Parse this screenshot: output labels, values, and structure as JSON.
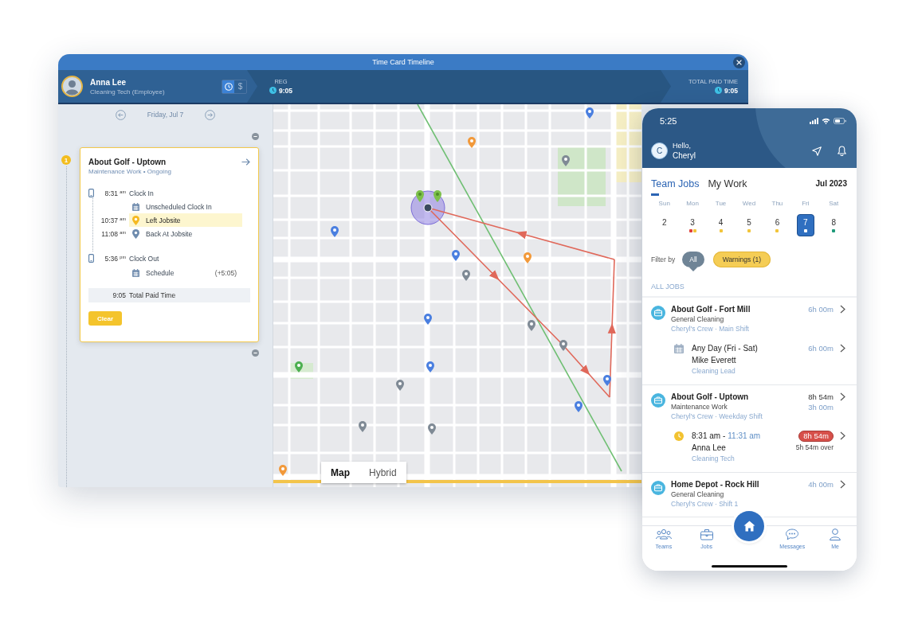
{
  "window": {
    "title": "Time Card Timeline"
  },
  "employee": {
    "name": "Anna Lee",
    "role": "Cleaning Tech (Employee)"
  },
  "view_toggle": [
    {
      "kind": "time",
      "selected": true
    },
    {
      "kind": "pay",
      "label": "$",
      "selected": false
    }
  ],
  "totals": [
    {
      "label": "REG",
      "value": "9:05"
    },
    {
      "label": "TOTAL PAID TIME",
      "value": "9:05"
    }
  ],
  "timeline": {
    "date": "Friday, Jul 7",
    "entries": [
      {
        "number": "1",
        "title": "About Golf - Uptown",
        "subtitle": "Maintenance Work • Ongoing",
        "events": [
          {
            "kind": "device",
            "time": "8:31 $^{am}$",
            "label": "Clock In",
            "highlighted": false
          },
          {
            "kind": "schedule",
            "label": "Unscheduled Clock In",
            "highlighted": false
          },
          {
            "kind": "location",
            "time": "10:37 $^{am}$",
            "label": "Left Jobsite",
            "highlighted": true
          },
          {
            "kind": "location",
            "time": "11:08 $^{am}$",
            "label": "Back At Jobsite",
            "highlighted": false
          },
          {
            "kind": "device",
            "time": "5:36 $^{pm}$",
            "label": "Clock Out",
            "highlighted": false
          },
          {
            "kind": "schedule",
            "label": "Schedule",
            "note": "(+5:05)",
            "highlighted": false
          }
        ],
        "total": {
          "value": "9:05",
          "label": "Total Paid Time"
        },
        "button": "Clear"
      }
    ]
  },
  "map": {
    "types": [
      {
        "label": "Map",
        "selected": true
      },
      {
        "label": "Hybrid",
        "selected": false
      }
    ]
  },
  "phone": {
    "clock": "5:25",
    "avatar_letter": "C",
    "greeting": "Hello,",
    "user": "Cheryl",
    "tabs": [
      {
        "label": "Team Jobs",
        "selected": true
      },
      {
        "label": "My Work",
        "selected": false
      }
    ],
    "month": "Jul 2023",
    "week": [
      {
        "day": "Sun",
        "date": "2",
        "selected": false
      },
      {
        "day": "Mon",
        "date": "3",
        "selected": false,
        "dots": [
          {
            "color": "#e0413a"
          },
          {
            "color": "#f2c53b"
          }
        ]
      },
      {
        "day": "Tue",
        "date": "4",
        "selected": false,
        "dots": [
          {
            "color": "#f2c53b"
          }
        ]
      },
      {
        "day": "Wed",
        "date": "5",
        "selected": false,
        "dots": [
          {
            "color": "#f2c53b"
          }
        ]
      },
      {
        "day": "Thu",
        "date": "6",
        "selected": false,
        "dots": [
          {
            "color": "#f2c53b"
          }
        ]
      },
      {
        "day": "Fri",
        "date": "7",
        "selected": true,
        "dots": [
          {
            "color": "#ffffff"
          }
        ]
      },
      {
        "day": "Sat",
        "date": "8",
        "selected": false,
        "dots": [
          {
            "color": "#1f9a7a"
          }
        ]
      }
    ],
    "filter": {
      "label": "Filter by",
      "chips": [
        {
          "label": "All",
          "kind": "all",
          "selected": true
        },
        {
          "label": "Warnings (1)",
          "kind": "warning",
          "selected": false
        }
      ]
    },
    "section": "ALL JOBS",
    "jobs": [
      {
        "title": "About Golf - Fort Mill",
        "type": "General Cleaning",
        "crew": "Cheryl's Crew · Main Shift",
        "hours": [
          {
            "text": "6h 00m",
            "kind": "scheduled"
          }
        ],
        "shifts": [
          {
            "kind": "open",
            "when": "Any Day (Fri - Sat)",
            "person": "Mike Everett",
            "role": "Cleaning Lead",
            "hours": [
              {
                "text": "6h 00m",
                "kind": "scheduled"
              }
            ]
          }
        ]
      },
      {
        "title": "About Golf - Uptown",
        "type": "Maintenance Work",
        "crew": "Cheryl's Crew · Weekday Shift",
        "hours": [
          {
            "text": "8h 54m",
            "kind": "actual"
          },
          {
            "text": "3h 00m",
            "kind": "scheduled"
          }
        ],
        "shifts": [
          {
            "kind": "clocked",
            "when": "8:31 am -",
            "until": "11:31 am",
            "person": "Anna Lee",
            "role": "Cleaning Tech",
            "hours": [
              {
                "text": "8h 54m",
                "kind": "overtime"
              },
              {
                "text": "5h 54m over",
                "kind": "note"
              }
            ]
          }
        ]
      },
      {
        "title": "Home Depot - Rock Hill",
        "type": "General Cleaning",
        "crew": "Cheryl's Crew · Shift 1",
        "hours": [
          {
            "text": "4h 00m",
            "kind": "scheduled"
          }
        ]
      }
    ],
    "nav": [
      {
        "kind": "teams",
        "label": "Teams"
      },
      {
        "kind": "jobs",
        "label": "Jobs"
      },
      {
        "kind": "home"
      },
      {
        "kind": "messages",
        "label": "Messages"
      },
      {
        "kind": "me",
        "label": "Me"
      }
    ]
  }
}
